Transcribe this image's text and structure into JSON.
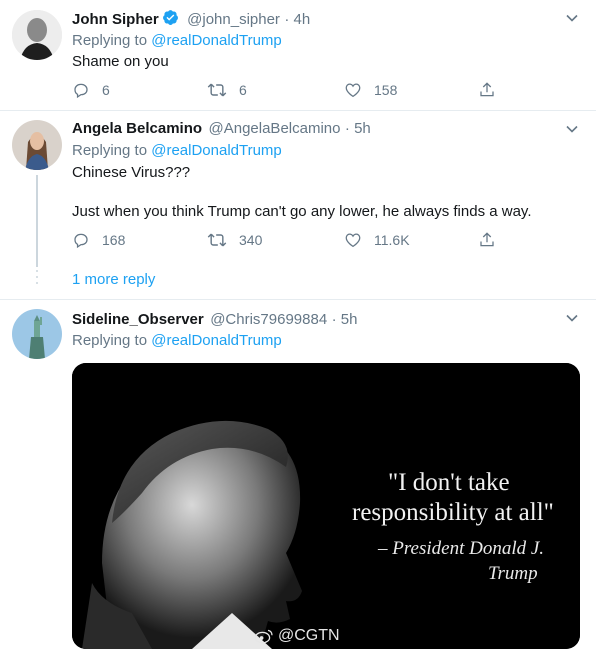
{
  "tweets": [
    {
      "name": "John Sipher",
      "handle": "@john_sipher",
      "time": "· 4h",
      "replying_prefix": "Replying to ",
      "replying_to": "@realDonaldTrump",
      "text": "Shame on you",
      "replies": "6",
      "retweets": "6",
      "likes": "158",
      "verified": true
    },
    {
      "name": "Angela Belcamino",
      "handle": "@AngelaBelcamino",
      "time": "· 5h",
      "replying_prefix": "Replying to ",
      "replying_to": "@realDonaldTrump",
      "text_line1": "Chinese Virus???",
      "text_line2": "Just when you think Trump can't go any lower, he always finds a way.",
      "replies": "168",
      "retweets": "340",
      "likes": "11.6K"
    },
    {
      "name": "Sideline_Observer",
      "handle": "@Chris79699884",
      "time": "· 5h",
      "replying_prefix": "Replying to ",
      "replying_to": "@realDonaldTrump"
    }
  ],
  "more_replies": "1 more reply",
  "image": {
    "quote_line1": "\"I don't take",
    "quote_line2": "responsibility at all\"",
    "attribution_line1": "– President Donald J.",
    "attribution_line2": "Trump",
    "watermark": "@CGTN"
  },
  "colors": {
    "accent": "#1da1f2",
    "secondary_text": "#657786",
    "separator": "#e6ecf0"
  }
}
